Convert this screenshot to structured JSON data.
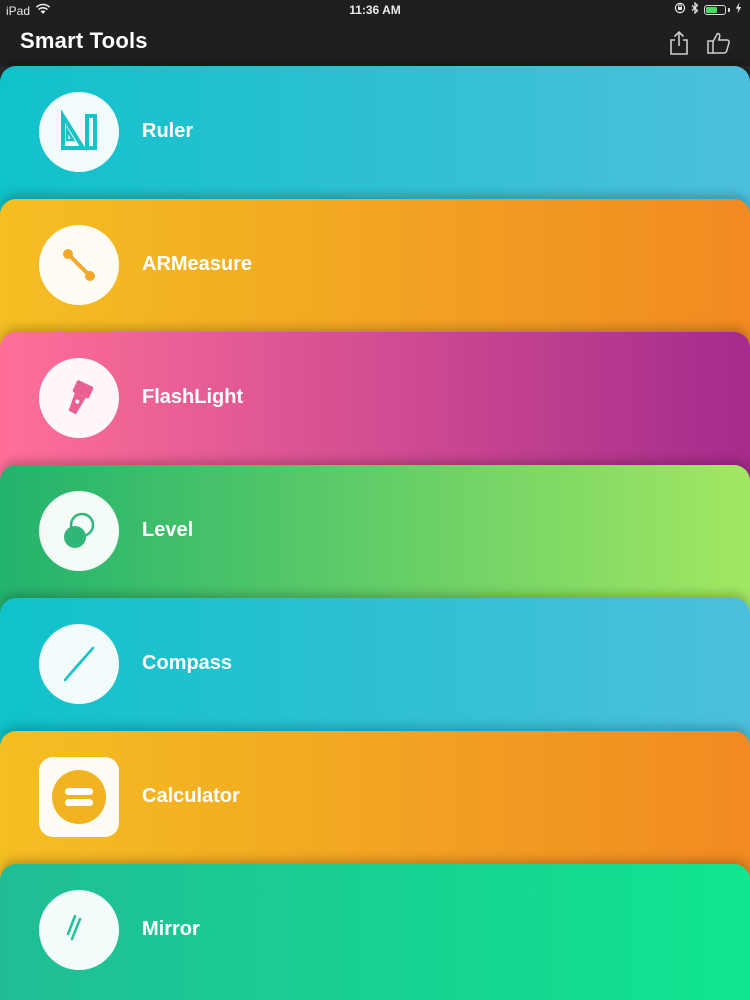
{
  "status_bar": {
    "device": "iPad",
    "time": "11:36 AM",
    "battery_level": 0.6,
    "icons": [
      "wifi-icon",
      "orientation-lock-icon",
      "bluetooth-icon",
      "battery-icon",
      "charging-icon"
    ]
  },
  "nav": {
    "title": "Smart Tools",
    "share_icon": "share-icon",
    "like_icon": "thumbs-up-icon"
  },
  "tools": [
    {
      "label": "Ruler",
      "icon": "ruler-icon",
      "gradient": [
        "#10c2c9",
        "#4cbfdc"
      ],
      "icon_color": "#17c3c9"
    },
    {
      "label": "ARMeasure",
      "icon": "measure-icon",
      "gradient": [
        "#f4bf22",
        "#f18a22"
      ],
      "icon_color": "#f3a72a"
    },
    {
      "label": "FlashLight",
      "icon": "flashlight-icon",
      "gradient": [
        "#ff6f98",
        "#a52b8c"
      ],
      "icon_color": "#ec5f95"
    },
    {
      "label": "Level",
      "icon": "level-icon",
      "gradient": [
        "#22b36d",
        "#a2e762"
      ],
      "icon_color": "#2fb678"
    },
    {
      "label": "Compass",
      "icon": "compass-icon",
      "gradient": [
        "#10c2c9",
        "#4cbfdc"
      ],
      "icon_color": "#17c3c9"
    },
    {
      "label": "Calculator",
      "icon": "calculator-icon",
      "gradient": [
        "#f4bf22",
        "#f18a22"
      ],
      "icon_color": "#f2b320"
    },
    {
      "label": "Mirror",
      "icon": "mirror-icon",
      "gradient": [
        "#20bd95",
        "#10e58f"
      ],
      "icon_color": "#22c39c"
    }
  ]
}
